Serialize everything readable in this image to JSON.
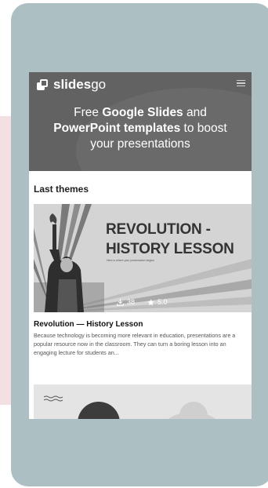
{
  "header": {
    "logo_text": "slides",
    "logo_suffix": "go",
    "headline_1": "Free ",
    "headline_2": "Google Slides",
    "headline_3": " and",
    "headline_4": "PowerPoint templates",
    "headline_5": " to boost",
    "headline_6": "your presentations"
  },
  "section": {
    "title": "Last themes"
  },
  "card": {
    "thumb_title_line1": "REVOLUTION -",
    "thumb_title_line2": "HISTORY LESSON",
    "thumb_subtitle": "Here is where your presentation begins",
    "downloads": "38",
    "rating": "5.0",
    "title": "Revolution — History Lesson",
    "description": "Because technology is becoming more relevant in education, presentations are a popular resource now in the classroom. They can turn a boring lesson into an engaging lecture for students an..."
  },
  "icons": {
    "logo": "slidesgo-logo-icon",
    "menu": "hamburger-menu-icon",
    "downloads": "download-icon",
    "rating": "star-icon"
  },
  "colors": {
    "background_blob": "#f3e0e3",
    "device": "#acc0c3",
    "hero": "#626262"
  }
}
